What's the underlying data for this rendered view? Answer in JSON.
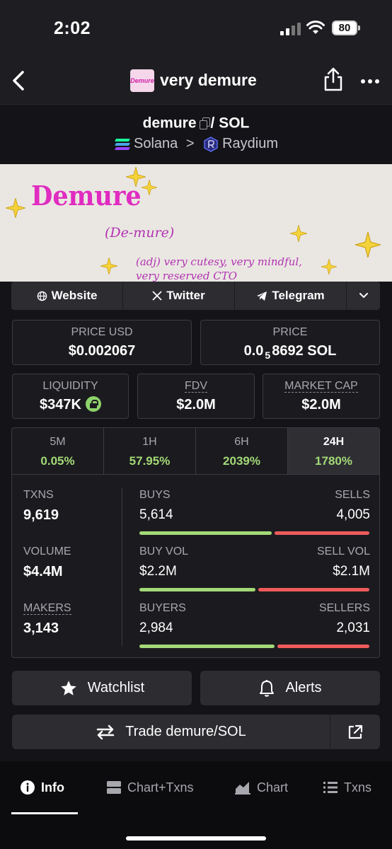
{
  "status_bar": {
    "time": "2:02",
    "battery": "80"
  },
  "nav": {
    "title": "very demure",
    "logo_text": "Demure"
  },
  "pair": {
    "base": "demure",
    "separator": "/",
    "quote": "SOL",
    "chain": "Solana",
    "chevron": ">",
    "dex": "Raydium"
  },
  "banner": {
    "title": "Demure",
    "pronunciation": "(De-mure)",
    "definition_line1": "(adj)  very cutesy, very mindful,",
    "definition_line2": "very reserved CTO"
  },
  "links": [
    {
      "label": "Website",
      "icon": "globe-icon"
    },
    {
      "label": "Twitter",
      "icon": "x-icon"
    },
    {
      "label": "Telegram",
      "icon": "telegram-icon"
    }
  ],
  "price_usd": {
    "label": "PRICE USD",
    "value": "$0.002067"
  },
  "price_native": {
    "label": "PRICE",
    "prefix": "0.0",
    "subscript": "5",
    "digits": "8692",
    "unit": "SOL"
  },
  "liquidity": {
    "label": "LIQUIDITY",
    "value": "$347K"
  },
  "fdv": {
    "label": "FDV",
    "value": "$2.0M"
  },
  "market_cap": {
    "label": "MARKET CAP",
    "value": "$2.0M"
  },
  "timeframes": [
    {
      "label": "5M",
      "change": "0.05%"
    },
    {
      "label": "1H",
      "change": "57.95%"
    },
    {
      "label": "6H",
      "change": "2039%"
    },
    {
      "label": "24H",
      "change": "1780%",
      "active": true
    }
  ],
  "stats": {
    "txns": {
      "label": "TXNS",
      "value": "9,619",
      "buys_label": "BUYS",
      "buys": "5,614",
      "sells_label": "SELLS",
      "sells": "4,005",
      "buy_fraction": 0.584
    },
    "volume": {
      "label": "VOLUME",
      "value": "$4.4M",
      "buys_label": "BUY VOL",
      "buys": "$2.2M",
      "sells_label": "SELL VOL",
      "sells": "$2.1M",
      "buy_fraction": 0.512
    },
    "makers": {
      "label": "MAKERS",
      "value": "3,143",
      "buys_label": "BUYERS",
      "buys": "2,984",
      "sells_label": "SELLERS",
      "sells": "2,031",
      "buy_fraction": 0.595
    }
  },
  "actions": {
    "watchlist": "Watchlist",
    "alerts": "Alerts",
    "trade": "Trade demure/SOL"
  },
  "bottom_tabs": [
    {
      "label": "Info",
      "active": true
    },
    {
      "label": "Chart+Txns"
    },
    {
      "label": "Chart"
    },
    {
      "label": "Txns"
    }
  ],
  "colors": {
    "accent_green": "#a3d977",
    "accent_red": "#ef5b5b",
    "background": "#141418",
    "card": "#1b1b1f"
  }
}
